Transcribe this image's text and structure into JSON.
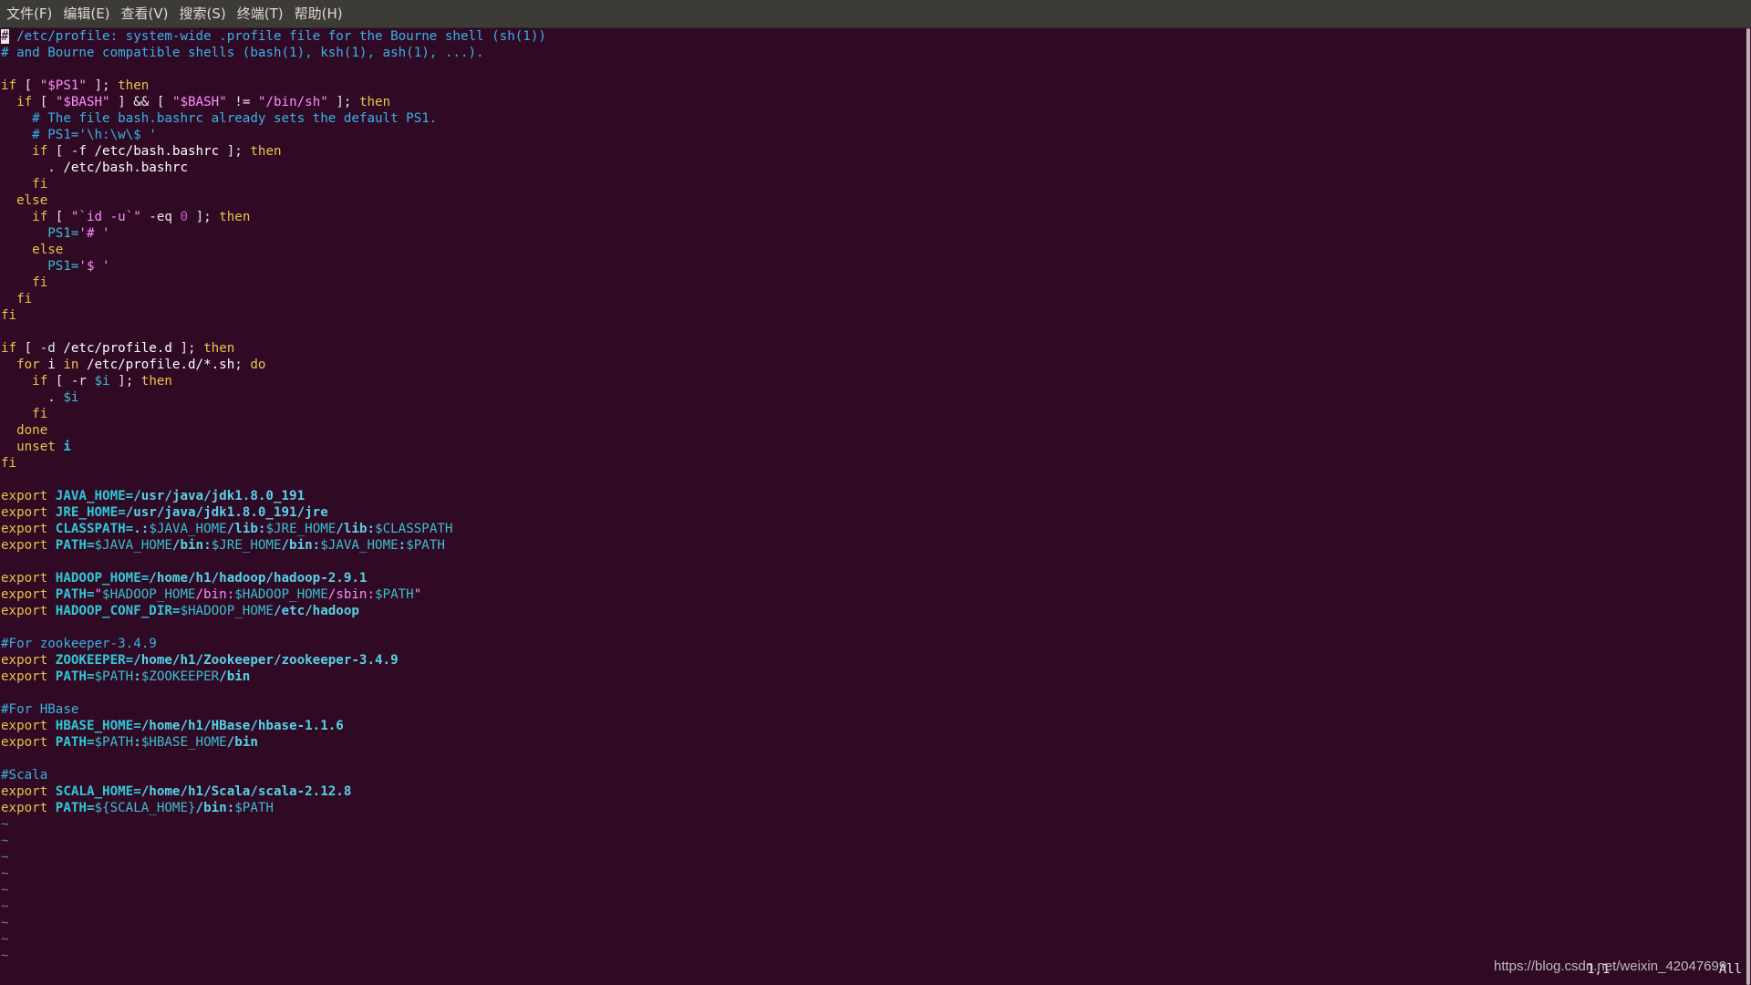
{
  "menubar": {
    "items": [
      "文件(F)",
      "编辑(E)",
      "查看(V)",
      "搜索(S)",
      "终端(T)",
      "帮助(H)"
    ]
  },
  "editor": {
    "lines": [
      [
        [
          "cursor",
          "#"
        ],
        [
          "comment",
          " /etc/profile: system-wide .profile file for the Bourne shell (sh(1))"
        ]
      ],
      [
        [
          "comment",
          "# and Bourne compatible shells (bash(1), ksh(1), ash(1), ...)."
        ]
      ],
      [],
      [
        [
          "kw",
          "if"
        ],
        [
          "op",
          " [ "
        ],
        [
          "str",
          "\"$PS1\""
        ],
        [
          "op",
          " ]; "
        ],
        [
          "kw",
          "then"
        ]
      ],
      [
        [
          "op",
          "  "
        ],
        [
          "kw",
          "if"
        ],
        [
          "op",
          " [ "
        ],
        [
          "str",
          "\"$BASH\""
        ],
        [
          "op",
          " ] && [ "
        ],
        [
          "str",
          "\"$BASH\""
        ],
        [
          "op",
          " != "
        ],
        [
          "str",
          "\"/bin/sh\""
        ],
        [
          "op",
          " ]; "
        ],
        [
          "kw",
          "then"
        ]
      ],
      [
        [
          "comment",
          "    # The file bash.bashrc already sets the default PS1."
        ]
      ],
      [
        [
          "comment",
          "    # PS1='\\h:\\w\\$ '"
        ]
      ],
      [
        [
          "op",
          "    "
        ],
        [
          "kw",
          "if"
        ],
        [
          "op",
          " [ -f "
        ],
        [
          "plain",
          "/etc/bash.bashrc"
        ],
        [
          "op",
          " ]; "
        ],
        [
          "kw",
          "then"
        ]
      ],
      [
        [
          "op",
          "      . "
        ],
        [
          "plain",
          "/etc/bash.bashrc"
        ]
      ],
      [
        [
          "op",
          "    "
        ],
        [
          "kw",
          "fi"
        ]
      ],
      [
        [
          "op",
          "  "
        ],
        [
          "kw",
          "else"
        ]
      ],
      [
        [
          "op",
          "    "
        ],
        [
          "kw",
          "if"
        ],
        [
          "op",
          " [ "
        ],
        [
          "str",
          "\"`id -u`\""
        ],
        [
          "op",
          " -eq "
        ],
        [
          "num",
          "0"
        ],
        [
          "op",
          " ]; "
        ],
        [
          "kw",
          "then"
        ]
      ],
      [
        [
          "op",
          "      "
        ],
        [
          "ref",
          "PS1="
        ],
        [
          "str",
          "'# '"
        ]
      ],
      [
        [
          "op",
          "    "
        ],
        [
          "kw",
          "else"
        ]
      ],
      [
        [
          "op",
          "      "
        ],
        [
          "ref",
          "PS1="
        ],
        [
          "str",
          "'$ '"
        ]
      ],
      [
        [
          "op",
          "    "
        ],
        [
          "kw",
          "fi"
        ]
      ],
      [
        [
          "op",
          "  "
        ],
        [
          "kw",
          "fi"
        ]
      ],
      [
        [
          "kw",
          "fi"
        ]
      ],
      [],
      [
        [
          "kw",
          "if"
        ],
        [
          "op",
          " [ -d "
        ],
        [
          "plain",
          "/etc/profile.d"
        ],
        [
          "op",
          " ]; "
        ],
        [
          "kw",
          "then"
        ]
      ],
      [
        [
          "op",
          "  "
        ],
        [
          "kw",
          "for"
        ],
        [
          "plain",
          " i "
        ],
        [
          "kw",
          "in"
        ],
        [
          "plain",
          " /etc/profile.d/*.sh"
        ],
        [
          "op",
          "; "
        ],
        [
          "kw",
          "do"
        ]
      ],
      [
        [
          "op",
          "    "
        ],
        [
          "kw",
          "if"
        ],
        [
          "op",
          " [ -r "
        ],
        [
          "ref",
          "$i"
        ],
        [
          "op",
          " ]; "
        ],
        [
          "kw",
          "then"
        ]
      ],
      [
        [
          "op",
          "      . "
        ],
        [
          "ref",
          "$i"
        ]
      ],
      [
        [
          "op",
          "    "
        ],
        [
          "kw",
          "fi"
        ]
      ],
      [
        [
          "op",
          "  "
        ],
        [
          "kw",
          "done"
        ]
      ],
      [
        [
          "op",
          "  "
        ],
        [
          "kw",
          "unset"
        ],
        [
          "var",
          " i"
        ]
      ],
      [
        [
          "kw",
          "fi"
        ]
      ],
      [],
      [
        [
          "kw",
          "export"
        ],
        [
          "var",
          " JAVA_HOME="
        ],
        [
          "path",
          "/usr/java/jdk1.8.0_191"
        ]
      ],
      [
        [
          "kw",
          "export"
        ],
        [
          "var",
          " JRE_HOME="
        ],
        [
          "path",
          "/usr/java/jdk1.8.0_191/jre"
        ]
      ],
      [
        [
          "kw",
          "export"
        ],
        [
          "var",
          " CLASSPATH="
        ],
        [
          "path",
          ".:"
        ],
        [
          "ref",
          "$JAVA_HOME"
        ],
        [
          "path",
          "/lib:"
        ],
        [
          "ref",
          "$JRE_HOME"
        ],
        [
          "path",
          "/lib:"
        ],
        [
          "ref",
          "$CLASSPATH"
        ]
      ],
      [
        [
          "kw",
          "export"
        ],
        [
          "var",
          " PATH="
        ],
        [
          "ref",
          "$JAVA_HOME"
        ],
        [
          "path",
          "/bin:"
        ],
        [
          "ref",
          "$JRE_HOME"
        ],
        [
          "path",
          "/bin:"
        ],
        [
          "ref",
          "$JAVA_HOME"
        ],
        [
          "path",
          ":"
        ],
        [
          "ref",
          "$PATH"
        ]
      ],
      [],
      [
        [
          "kw",
          "export"
        ],
        [
          "var",
          " HADOOP_HOME="
        ],
        [
          "path",
          "/home/h1/hadoop/hadoop-2.9.1"
        ]
      ],
      [
        [
          "kw",
          "export"
        ],
        [
          "var",
          " PATH="
        ],
        [
          "str",
          "\""
        ],
        [
          "ref",
          "$HADOOP_HOME"
        ],
        [
          "str",
          "/bin:"
        ],
        [
          "ref",
          "$HADOOP_HOME"
        ],
        [
          "str",
          "/sbin:"
        ],
        [
          "ref",
          "$PATH"
        ],
        [
          "str",
          "\""
        ]
      ],
      [
        [
          "kw",
          "export"
        ],
        [
          "var",
          " HADOOP_CONF_DIR="
        ],
        [
          "ref",
          "$HADOOP_HOME"
        ],
        [
          "path",
          "/etc/hadoop"
        ]
      ],
      [],
      [
        [
          "comment",
          "#For zookeeper-3.4.9"
        ]
      ],
      [
        [
          "kw",
          "export"
        ],
        [
          "var",
          " ZOOKEEPER="
        ],
        [
          "path",
          "/home/h1/Zookeeper/zookeeper-3.4.9"
        ]
      ],
      [
        [
          "kw",
          "export"
        ],
        [
          "var",
          " PATH="
        ],
        [
          "ref",
          "$PATH"
        ],
        [
          "path",
          ":"
        ],
        [
          "ref",
          "$ZOOKEEPER"
        ],
        [
          "path",
          "/bin"
        ]
      ],
      [],
      [
        [
          "comment",
          "#For HBase"
        ]
      ],
      [
        [
          "kw",
          "export"
        ],
        [
          "var",
          " HBASE_HOME="
        ],
        [
          "path",
          "/home/h1/HBase/hbase-1.1.6"
        ]
      ],
      [
        [
          "kw",
          "export"
        ],
        [
          "var",
          " PATH="
        ],
        [
          "ref",
          "$PATH"
        ],
        [
          "path",
          ":"
        ],
        [
          "ref",
          "$HBASE_HOME"
        ],
        [
          "path",
          "/bin"
        ]
      ],
      [],
      [
        [
          "comment",
          "#Scala"
        ]
      ],
      [
        [
          "kw",
          "export"
        ],
        [
          "var",
          " SCALA_HOME="
        ],
        [
          "path",
          "/home/h1/Scala/scala-2.12.8"
        ]
      ],
      [
        [
          "kw",
          "export"
        ],
        [
          "var",
          " PATH="
        ],
        [
          "ref",
          "${SCALA_HOME}"
        ],
        [
          "path",
          "/bin:"
        ],
        [
          "ref",
          "$PATH"
        ]
      ],
      [
        [
          "tilde",
          "~"
        ]
      ],
      [
        [
          "tilde",
          "~"
        ]
      ],
      [
        [
          "tilde",
          "~"
        ]
      ],
      [
        [
          "tilde",
          "~"
        ]
      ],
      [
        [
          "tilde",
          "~"
        ]
      ],
      [
        [
          "tilde",
          "~"
        ]
      ],
      [
        [
          "tilde",
          "~"
        ]
      ],
      [
        [
          "tilde",
          "~"
        ]
      ],
      [
        [
          "tilde",
          "~"
        ]
      ]
    ]
  },
  "status": {
    "position": "1,1",
    "scroll": "All"
  },
  "watermark": "https://blog.csdn.net/weixin_42047699"
}
